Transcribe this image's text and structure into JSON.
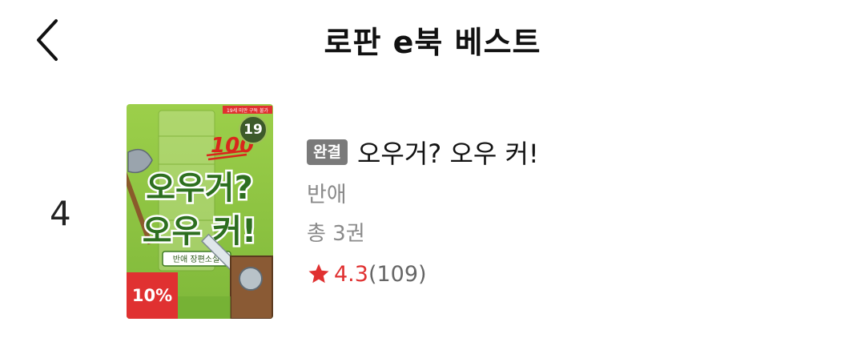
{
  "header": {
    "title": "로판 e북 베스트",
    "back_icon": "chevron-left-icon"
  },
  "book": {
    "rank": "4",
    "cover": {
      "title_line1": "오우거?",
      "title_line2": "오우 커!",
      "score_emoji": "100",
      "subtitle": "반애 장편소설",
      "top_banner": "19세 미만 구독 불가",
      "adult_badge": "19",
      "discount": "10%"
    },
    "status_tag": "완결",
    "title": "오우거? 오우 커!",
    "author": "반애",
    "volumes": "총 3권",
    "rating": "4.3",
    "review_count": "(109)",
    "colors": {
      "accent_red": "#e03131",
      "tag_gray": "#7a7a7a",
      "cover_green": "#8cc63f"
    }
  }
}
